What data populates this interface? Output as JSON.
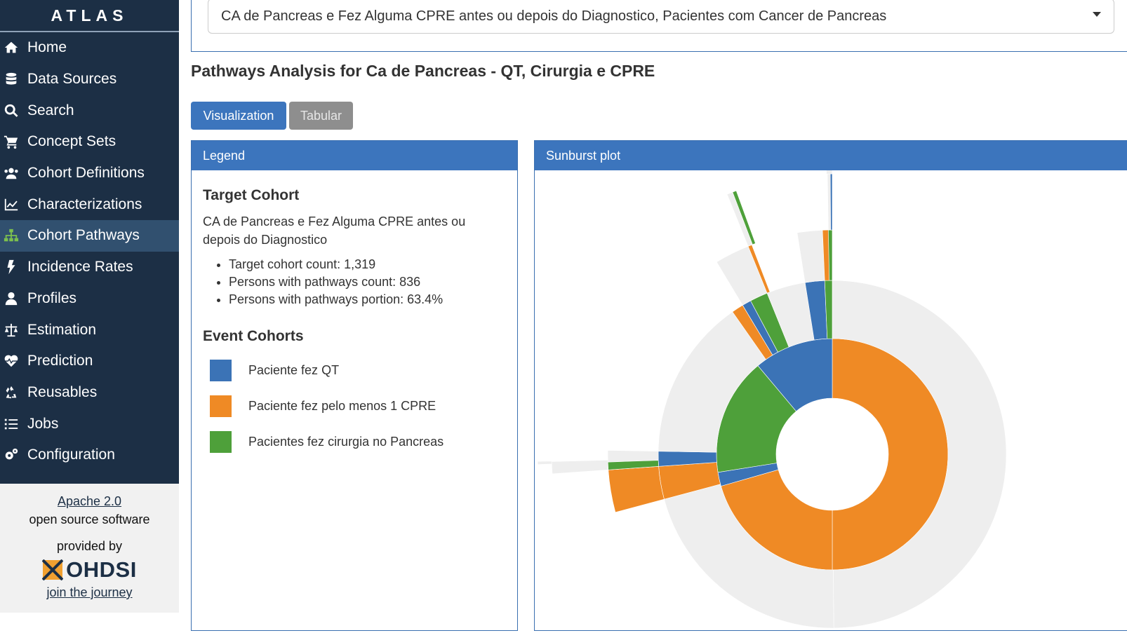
{
  "app": {
    "brand": "ATLAS"
  },
  "sidebar": {
    "items": [
      {
        "label": "Home",
        "icon": "home-icon"
      },
      {
        "label": "Data Sources",
        "icon": "database-icon"
      },
      {
        "label": "Search",
        "icon": "search-icon"
      },
      {
        "label": "Concept Sets",
        "icon": "shopping-cart-icon"
      },
      {
        "label": "Cohort Definitions",
        "icon": "users-icon"
      },
      {
        "label": "Characterizations",
        "icon": "line-chart-icon"
      },
      {
        "label": "Cohort Pathways",
        "icon": "sitemap-icon",
        "active": true
      },
      {
        "label": "Incidence Rates",
        "icon": "bolt-icon"
      },
      {
        "label": "Profiles",
        "icon": "user-icon"
      },
      {
        "label": "Estimation",
        "icon": "balance-scale-icon"
      },
      {
        "label": "Prediction",
        "icon": "heartbeat-icon"
      },
      {
        "label": "Reusables",
        "icon": "recycle-icon"
      },
      {
        "label": "Jobs",
        "icon": "list-icon"
      },
      {
        "label": "Configuration",
        "icon": "cogs-icon"
      }
    ],
    "footer": {
      "license_link": "Apache 2.0",
      "license_text": "open source software",
      "provided_by": "provided by",
      "org": "OHDSI",
      "journey_link": "join the journey"
    }
  },
  "main": {
    "cohort_select_value": "CA de Pancreas e Fez Alguma CPRE antes ou depois do Diagnostico, Pacientes com Cancer de Pancreas",
    "title": "Pathways Analysis for Ca de Pancreas - QT, Cirurgia e CPRE",
    "tabs": {
      "visualization": "Visualization",
      "tabular": "Tabular"
    },
    "legend": {
      "header": "Legend",
      "target_heading": "Target Cohort",
      "target_name": "CA de Pancreas e Fez Alguma CPRE antes ou depois do Diagnostico",
      "stats": [
        "Target cohort count: 1,319",
        "Persons with pathways count: 836",
        "Persons with pathways portion: 63.4%"
      ],
      "event_heading": "Event Cohorts",
      "events": [
        {
          "label": "Paciente fez QT",
          "color": "#3b73b6"
        },
        {
          "label": "Paciente fez pelo menos 1 CPRE",
          "color": "#ef8a25"
        },
        {
          "label": "Pacientes fez cirurgia no Pancreas",
          "color": "#4ea03a"
        }
      ]
    },
    "sunburst": {
      "header": "Sunburst plot"
    }
  },
  "colors": {
    "qt": "#3b73b6",
    "cpre": "#ef8a25",
    "cirurgia": "#4ea03a",
    "no_event": "#eeeeee",
    "sidebar": "#1c2f45",
    "accent": "#3c75bd"
  }
}
